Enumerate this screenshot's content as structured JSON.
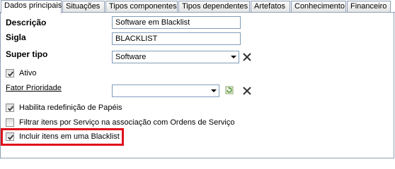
{
  "tabs": [
    {
      "label": "Dados principais",
      "active": true
    },
    {
      "label": "Situações",
      "active": false
    },
    {
      "label": "Tipos componentes",
      "active": false
    },
    {
      "label": "Tipos dependentes",
      "active": false
    },
    {
      "label": "Artefatos",
      "active": false
    },
    {
      "label": "Conhecimento",
      "active": false
    },
    {
      "label": "Financeiro",
      "active": false
    }
  ],
  "form": {
    "descricao_label": "Descrição",
    "descricao_value": "Software em Blacklist",
    "sigla_label": "Sigla",
    "sigla_value": "BLACKLIST",
    "super_tipo_label": "Super tipo",
    "super_tipo_value": "Software",
    "fator_prioridade_label": "Fator Prioridade",
    "fator_prioridade_value": ""
  },
  "checkboxes": {
    "ativo": {
      "label": "Ativo",
      "checked": true
    },
    "habilita_redefinicao": {
      "label": "Habilita redefinição de Papéis",
      "checked": true
    },
    "filtrar_itens": {
      "label": "Filtrar itens por Serviço na associação com Ordens de Serviço",
      "checked": false
    },
    "incluir_blacklist": {
      "label": "Incluir itens em uma Blacklist",
      "checked": true
    }
  },
  "icons": {
    "clear": "x-icon",
    "refresh": "refresh-icon",
    "dropdown": "chevron-down-icon",
    "check": "check-icon"
  },
  "colors": {
    "highlight": "#e0101b",
    "border": "#8f9eb4",
    "input_border": "#7f9db9"
  }
}
